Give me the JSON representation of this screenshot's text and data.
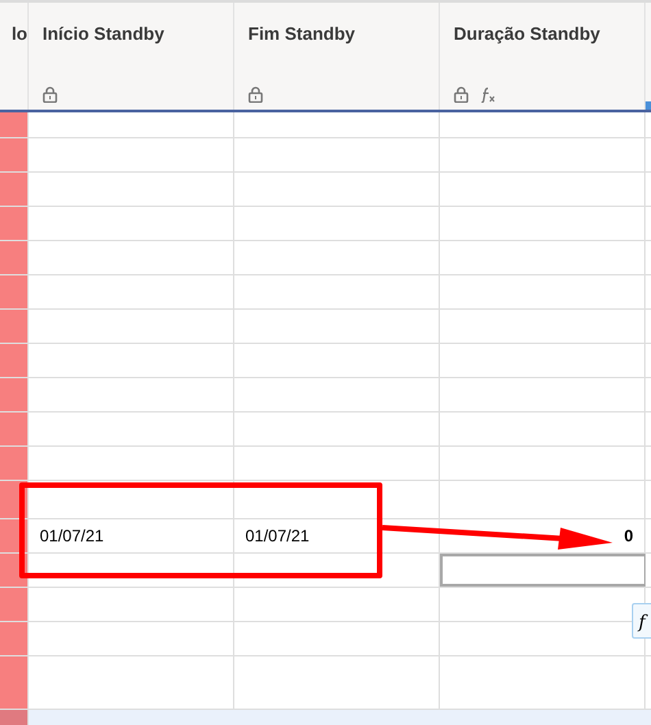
{
  "columns": [
    {
      "title": "lo",
      "locked": false,
      "formula": false
    },
    {
      "title": "Início Standby",
      "locked": true,
      "formula": false
    },
    {
      "title": "Fim Standby",
      "locked": true,
      "formula": false
    },
    {
      "title": "Duração Standby",
      "locked": true,
      "formula": true
    }
  ],
  "rows": [
    {
      "cells": [
        {
          "selected": false
        },
        {
          "selected": false
        },
        {
          "selected": false
        }
      ]
    },
    {
      "cells": [
        {
          "selected": false
        },
        {
          "selected": false
        },
        {
          "selected": false
        }
      ]
    },
    {
      "cells": [
        {
          "selected": false
        },
        {
          "selected": false
        },
        {
          "selected": false
        }
      ]
    },
    {
      "cells": [
        {
          "selected": false
        },
        {
          "selected": false
        },
        {
          "selected": false
        }
      ]
    },
    {
      "cells": [
        {
          "selected": false
        },
        {
          "selected": false
        },
        {
          "selected": false
        }
      ]
    },
    {
      "cells": [
        {
          "selected": false
        },
        {
          "selected": false
        },
        {
          "selected": false
        }
      ]
    },
    {
      "cells": [
        {
          "selected": false
        },
        {
          "selected": false
        },
        {
          "selected": false
        }
      ]
    },
    {
      "cells": [
        {
          "selected": false
        },
        {
          "selected": false
        },
        {
          "selected": false
        }
      ]
    },
    {
      "cells": [
        {
          "selected": false
        },
        {
          "selected": false
        },
        {
          "selected": false
        }
      ]
    },
    {
      "cells": [
        {
          "selected": false
        },
        {
          "selected": false
        },
        {
          "selected": false
        }
      ]
    },
    {
      "cells": [
        {
          "selected": false
        },
        {
          "selected": false
        },
        {
          "selected": false
        }
      ]
    },
    {
      "cells": [
        {
          "selected": false
        },
        {
          "selected": false
        },
        {
          "selected": false
        }
      ]
    },
    {
      "cells": [
        {
          "selected": false,
          "kind": "date",
          "text": "01/07/21"
        },
        {
          "selected": false,
          "kind": "date",
          "text": "01/07/21"
        },
        {
          "selected": false,
          "kind": "number",
          "text": "0"
        }
      ]
    },
    {
      "cells": [
        {
          "selected": false
        },
        {
          "selected": false
        },
        {
          "selected": true
        }
      ]
    },
    {
      "cells": [
        {
          "selected": false
        },
        {
          "selected": false
        },
        {
          "selected": false
        }
      ]
    },
    {
      "cells": [
        {
          "selected": false
        },
        {
          "selected": false
        },
        {
          "selected": false
        }
      ]
    },
    {
      "cells": [
        {
          "selected": false
        },
        {
          "selected": false
        },
        {
          "selected": false
        }
      ]
    }
  ],
  "tooltip": {
    "text": "f"
  }
}
